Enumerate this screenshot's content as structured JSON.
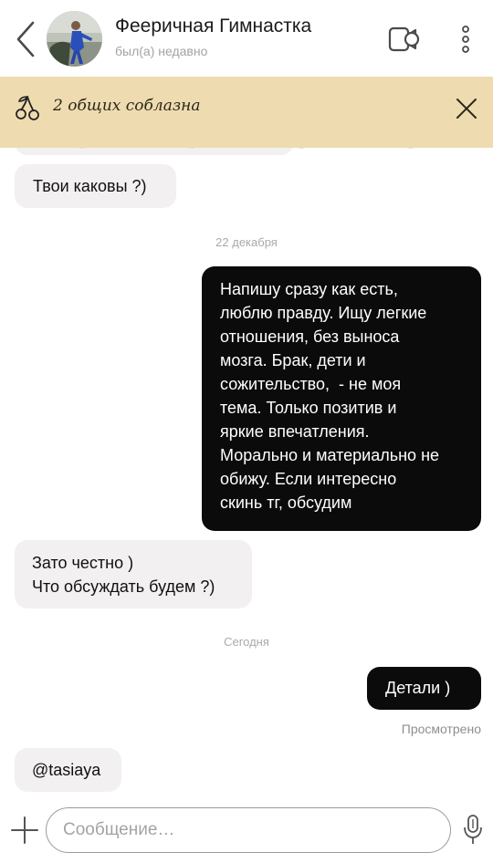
{
  "header": {
    "back_icon": "chevron-left-icon",
    "contact_name": "Фееричная Гимнастка",
    "status": "был(а) недавно",
    "call_icon": "video-call-icon",
    "more_icon": "more-vertical-icon"
  },
  "banner": {
    "icon": "cherries-icon",
    "text": "2 общих соблазна",
    "close_icon": "close-icon",
    "background": "#eedbb0"
  },
  "messages": [
    {
      "direction": "incoming",
      "text": "Твои каковы ?)"
    },
    {
      "direction": "separator",
      "text": "22 декабря"
    },
    {
      "direction": "outgoing",
      "lines": [
        "Напишу сразу как есть,",
        "люблю правду. Ищу легкие",
        "отношения, без выноса",
        "мозга. Брак, дети и",
        "сожительство,  - не моя",
        "тема. Только позитив и",
        "яркие впечатления.",
        "Морально и материально не",
        "обижу. Если интересно",
        "скинь тг, обсудим"
      ]
    },
    {
      "direction": "incoming",
      "lines": [
        "Зато честно )",
        "Что обсуждать будем ?)"
      ]
    },
    {
      "direction": "separator",
      "text": "Сегодня"
    },
    {
      "direction": "outgoing",
      "text": "Детали )"
    },
    {
      "direction": "status",
      "text": "Просмотрено"
    },
    {
      "direction": "incoming",
      "text": "@tasiaya"
    }
  ],
  "composer": {
    "add_icon": "plus-icon",
    "placeholder": "Сообщение…",
    "value": "",
    "mic_icon": "microphone-icon"
  },
  "colors": {
    "incoming_bubble": "#f2f0f1",
    "outgoing_bubble": "#0b0b0b",
    "banner": "#eedbb0"
  }
}
